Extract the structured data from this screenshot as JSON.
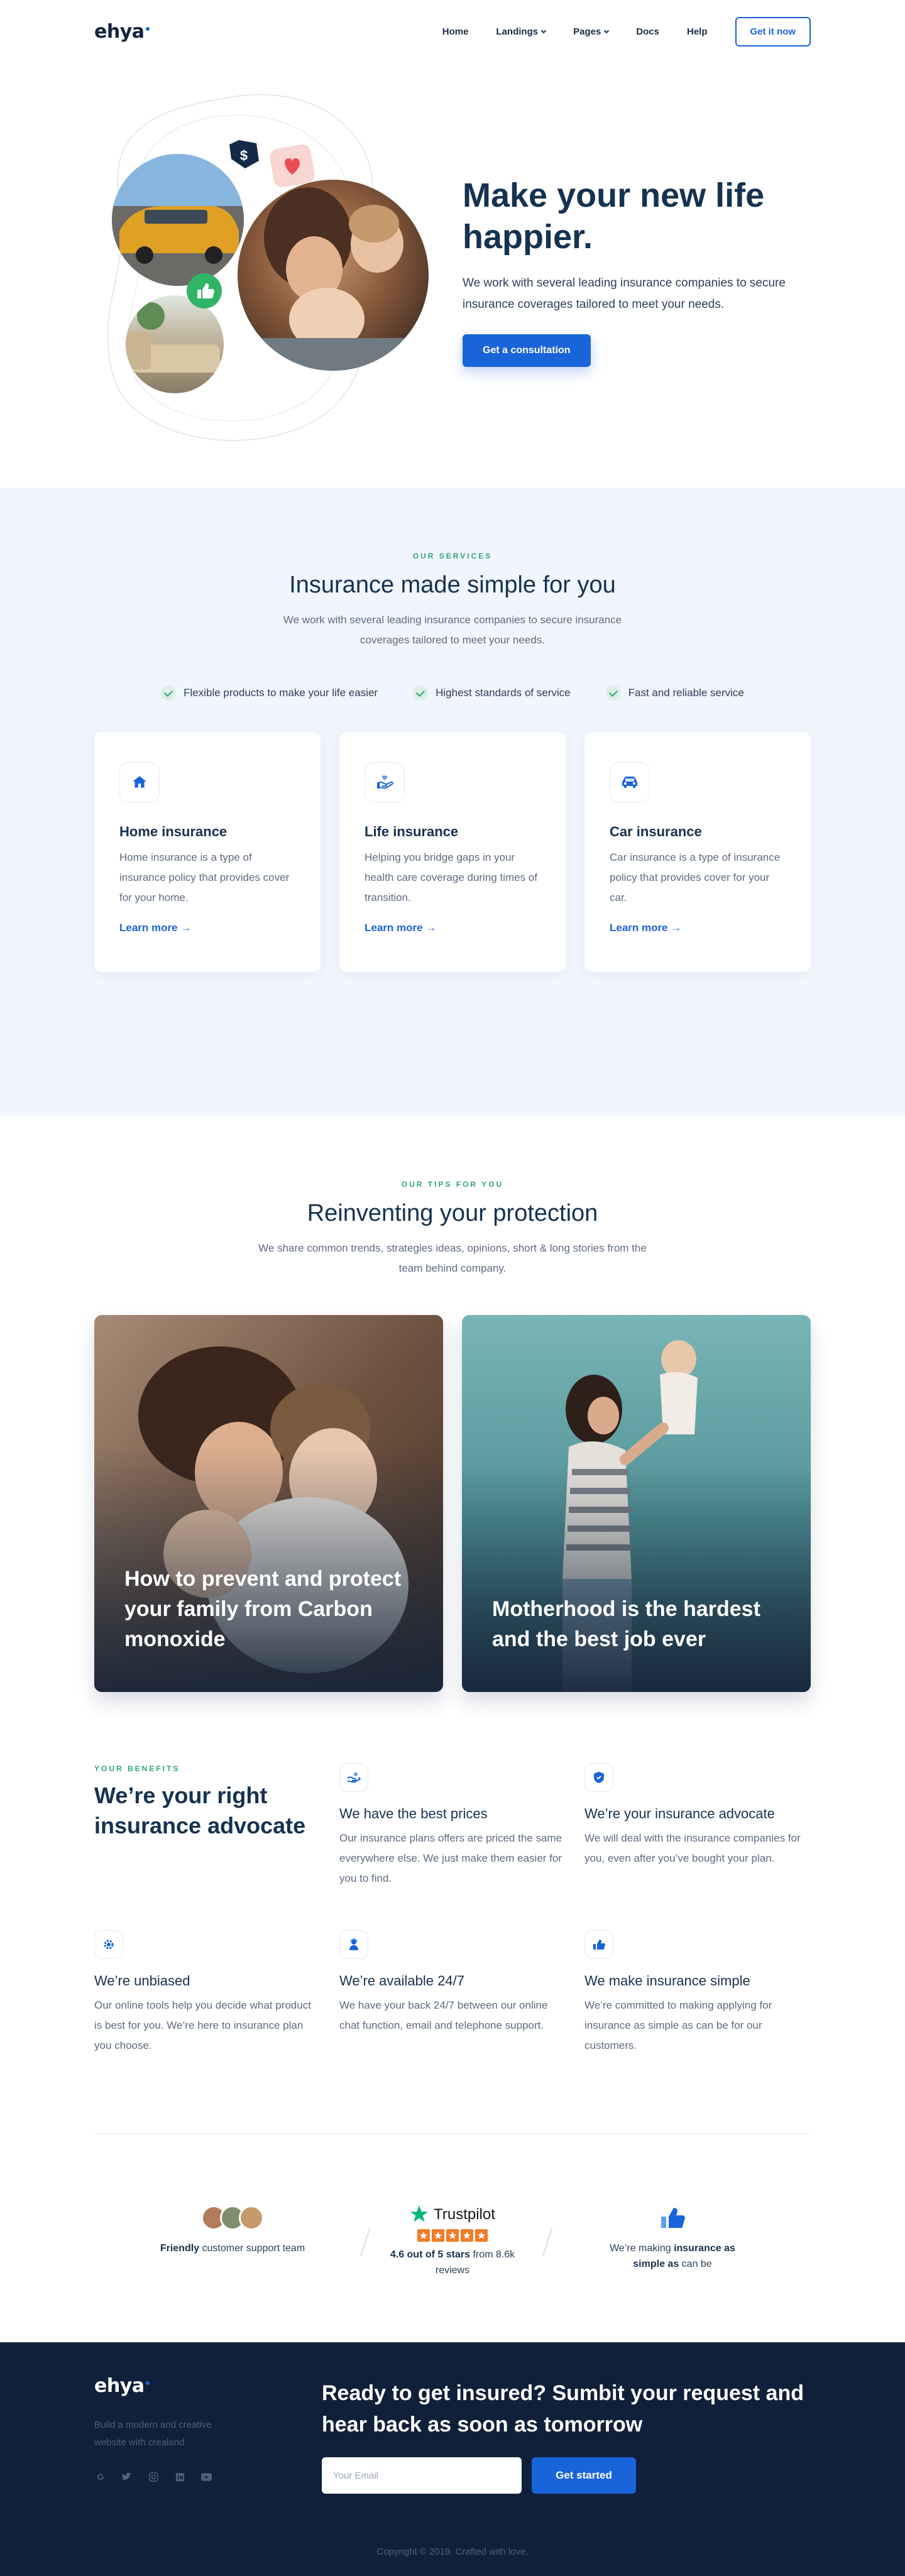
{
  "nav": {
    "logo": "ehya",
    "links": [
      "Home",
      "Landings",
      "Pages",
      "Docs",
      "Help"
    ],
    "cta": "Get it now"
  },
  "hero": {
    "title": "Make your new life happier.",
    "subtitle": "We work with several leading insurance companies to secure insurance coverages tailored to meet your needs.",
    "cta": "Get a consultation"
  },
  "services": {
    "eyebrow": "OUR SERVICES",
    "title": "Insurance made simple for you",
    "subtitle": "We work with several leading insurance companies to secure insurance coverages tailored to meet your needs.",
    "features": [
      "Flexible products to make your life easier",
      "Highest standards of service",
      "Fast and reliable service"
    ],
    "cards": [
      {
        "title": "Home insurance",
        "text": "Home insurance is a type of insurance policy that provides cover for your home.",
        "link": "Learn more",
        "icon": "house-icon"
      },
      {
        "title": "Life insurance",
        "text": "Helping you bridge gaps in your health care coverage during times of transition.",
        "link": "Learn more",
        "icon": "hand-heart-icon"
      },
      {
        "title": "Car insurance",
        "text": "Car insurance is a type of insurance policy that provides cover for your car.",
        "link": "Learn more",
        "icon": "car-icon"
      }
    ]
  },
  "tips": {
    "eyebrow": "OUR TIPS FOR YOU",
    "title": "Reinventing your protection",
    "subtitle": "We share common trends, strategies ideas, opinions, short & long stories from the team behind company.",
    "posts": [
      {
        "title": "How to prevent and protect your family from Carbon monoxide"
      },
      {
        "title": "Motherhood is the hardest and the best job ever"
      }
    ]
  },
  "benefits": {
    "eyebrow": "YOUR BENEFITS",
    "title": "We’re your right insurance advocate",
    "items": [
      {
        "title": "We have the best prices",
        "text": "Our insurance plans offers are priced the same everywhere else. We just make them easier for you to find.",
        "icon": "hand-coin-icon"
      },
      {
        "title": "We’re your insurance advocate",
        "text": "We will deal with the insurance companies for you, even after you’ve bought your plan.",
        "icon": "shield-icon"
      },
      {
        "title": "We’re unbiased",
        "text": "Our online tools help you decide what product is best for you. We’re here to insurance plan you choose.",
        "icon": "gear-icon"
      },
      {
        "title": "We’re available 24/7",
        "text": "We have your back 24/7 between our online chat function, email and telephone support.",
        "icon": "support-agent-icon"
      },
      {
        "title": "We make insurance simple",
        "text": "We’re committed to making applying for insurance as simple as can be for our customers.",
        "icon": "thumbs-up-icon"
      }
    ]
  },
  "proof": {
    "support_bold": "Friendly",
    "support_rest": " customer support team",
    "trustpilot_brand": "Trustpilot",
    "rating_bold": "4.6 out of 5 stars",
    "rating_rest": " from 8.6k reviews",
    "rating_value": 4.6,
    "simple_pre": "We’re making ",
    "simple_bold": "insurance as simple as",
    "simple_post": " can be"
  },
  "footer": {
    "logo": "ehya",
    "description": "Build a modern and creative website with crealand",
    "cta_title": "Ready to get insured? Sumbit your request and hear back as soon as tomorrow",
    "email_placeholder": "Your Email",
    "button": "Get started",
    "copyright": "Copyright © 2019. Crafted with love."
  },
  "colors": {
    "accent": "#1a64d9",
    "green": "#2ea86f",
    "navy": "#10203a",
    "services_bg": "#f1f5fd",
    "heart": "#ec4b56",
    "star": "#ef7d26"
  }
}
